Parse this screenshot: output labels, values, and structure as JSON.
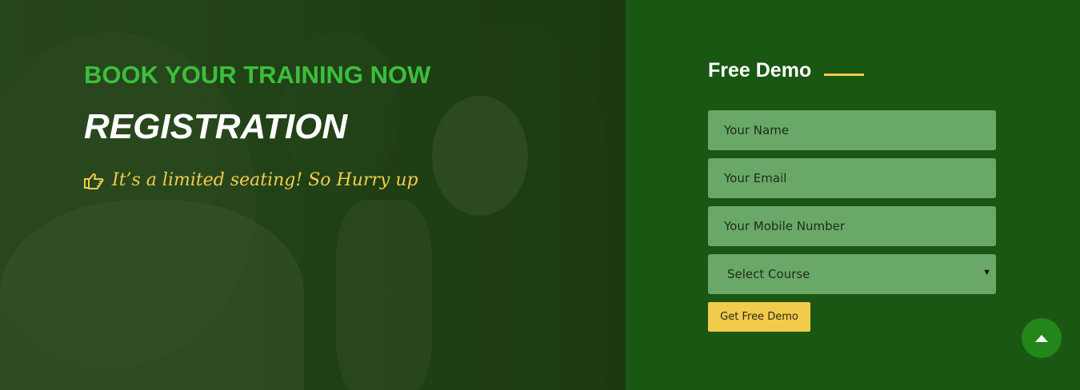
{
  "hero": {
    "kicker": "BOOK YOUR TRAINING NOW",
    "headline": "REGISTRATION",
    "tagline": "It’s a limited seating! So Hurry up",
    "tagline_icon": "hand-pointing-right-icon"
  },
  "form": {
    "title": "Free Demo",
    "name_placeholder": "Your Name",
    "email_placeholder": "Your Email",
    "mobile_placeholder": "Your Mobile Number",
    "course_selected": "Select Course",
    "submit_label": "Get Free Demo"
  },
  "back_to_top_icon": "arrow-up-icon",
  "colors": {
    "accent_green": "#3cbf3c",
    "accent_yellow": "#f2cb4b",
    "panel_green": "#195712",
    "field_green": "#6aa868",
    "back_to_top": "#23861a"
  }
}
